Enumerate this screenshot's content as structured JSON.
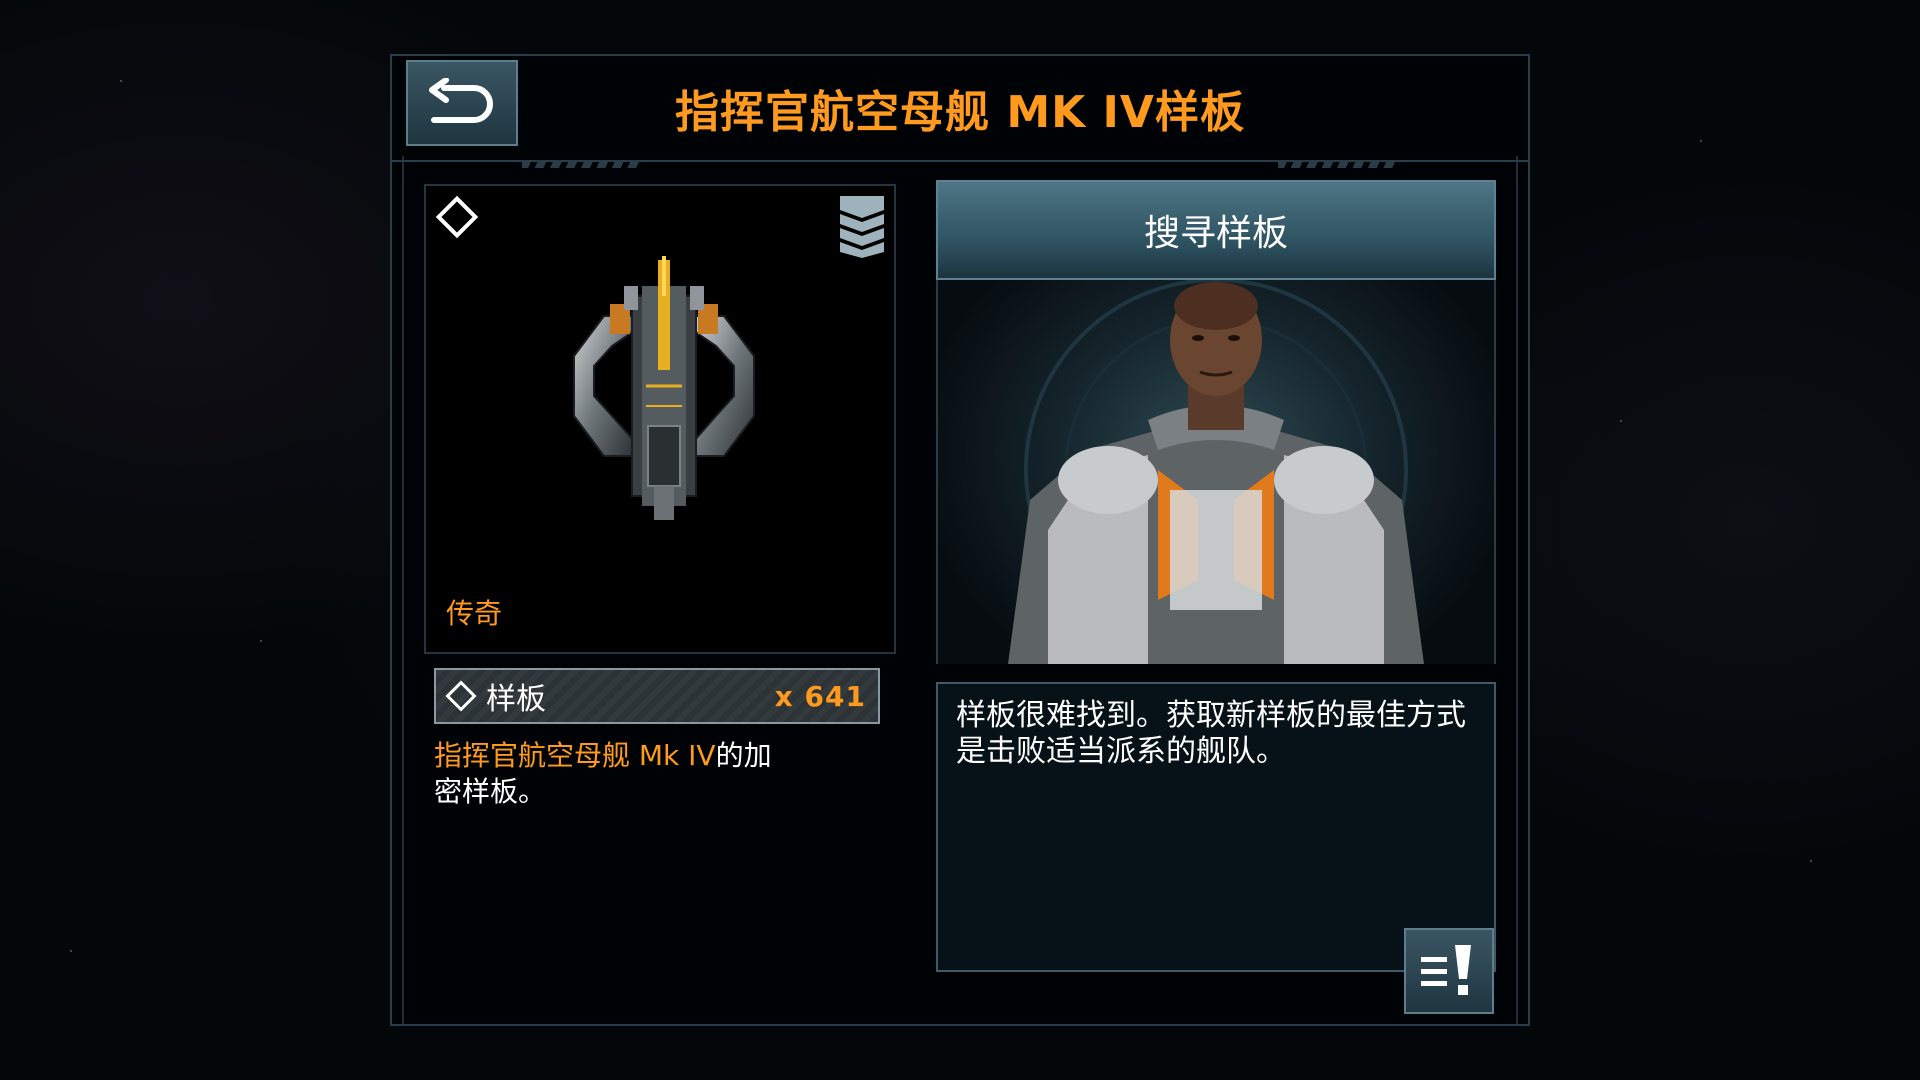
{
  "header": {
    "title": "指挥官航空母舰 MK IV样板",
    "back_icon": "back-arrow-icon"
  },
  "item": {
    "rarity": "传奇",
    "count_label": "样板",
    "count_value": "x 641",
    "desc_highlight": "指挥官航空母舰 Mk IV",
    "desc_rest": "的加密样板。"
  },
  "search": {
    "title": "搜寻样板",
    "info": "样板很难找到。获取新样板的最佳方式是击败适当派系的舰队。"
  },
  "colors": {
    "accent": "#ff9a1e",
    "button": "#2f4a55",
    "panel_border": "#2a3c48"
  }
}
